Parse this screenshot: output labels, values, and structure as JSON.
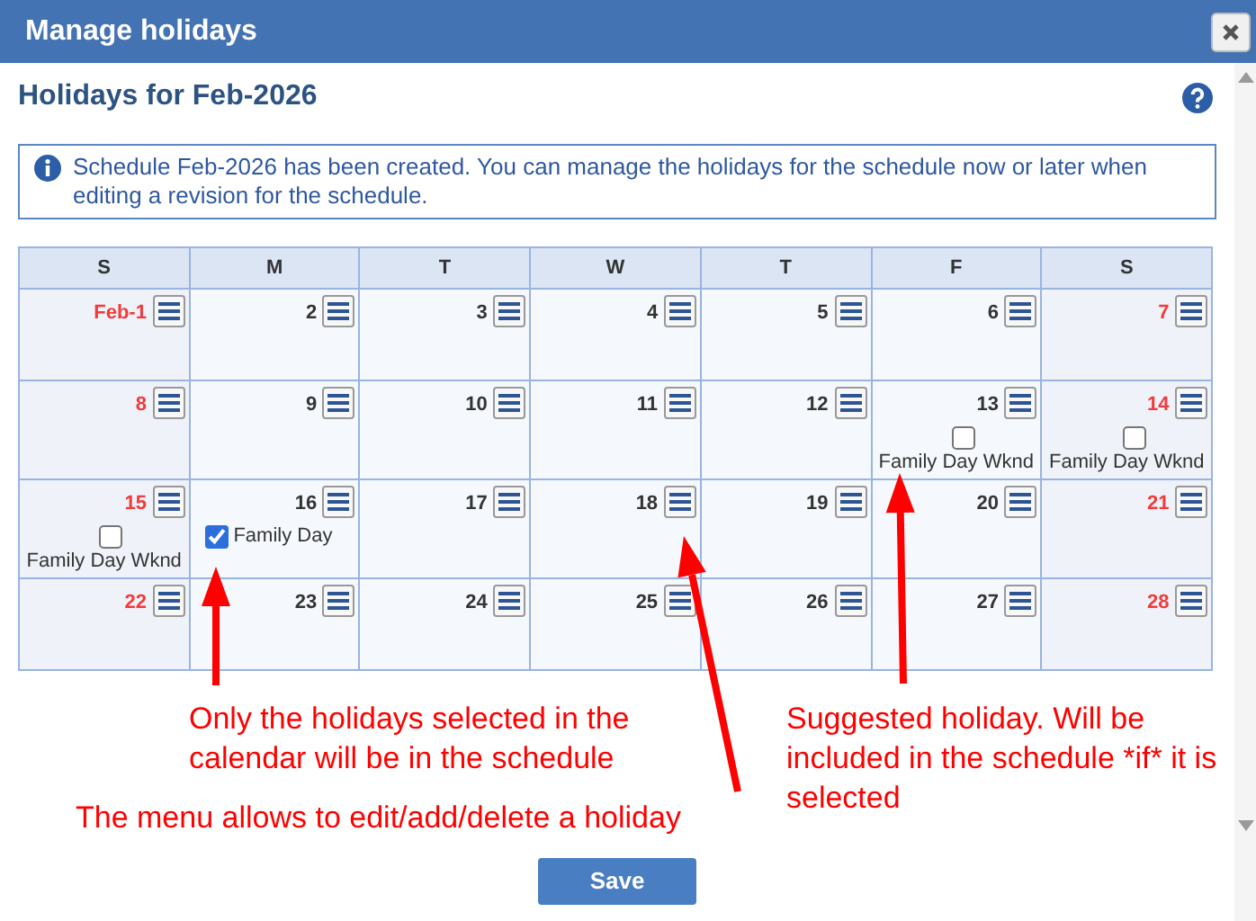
{
  "window": {
    "title": "Manage holidays"
  },
  "heading": "Holidays for Feb-2026",
  "info": "Schedule Feb-2026 has been created. You can manage the holidays for the schedule now or later when editing a revision for the schedule.",
  "calendar": {
    "columns": [
      "S",
      "M",
      "T",
      "W",
      "T",
      "F",
      "S"
    ],
    "weeks": [
      [
        {
          "date": "Feb-1",
          "weekend": true
        },
        {
          "date": "2",
          "weekend": false
        },
        {
          "date": "3",
          "weekend": false
        },
        {
          "date": "4",
          "weekend": false
        },
        {
          "date": "5",
          "weekend": false
        },
        {
          "date": "6",
          "weekend": false
        },
        {
          "date": "7",
          "weekend": true
        }
      ],
      [
        {
          "date": "8",
          "weekend": true
        },
        {
          "date": "9",
          "weekend": false
        },
        {
          "date": "10",
          "weekend": false
        },
        {
          "date": "11",
          "weekend": false
        },
        {
          "date": "12",
          "weekend": false
        },
        {
          "date": "13",
          "weekend": false,
          "holiday": {
            "name": "Family Day Wknd",
            "checked": false
          }
        },
        {
          "date": "14",
          "weekend": true,
          "holiday": {
            "name": "Family Day Wknd",
            "checked": false
          }
        }
      ],
      [
        {
          "date": "15",
          "weekend": true,
          "holiday": {
            "name": "Family Day Wknd",
            "checked": false
          }
        },
        {
          "date": "16",
          "weekend": false,
          "holiday": {
            "name": "Family Day",
            "checked": true
          }
        },
        {
          "date": "17",
          "weekend": false
        },
        {
          "date": "18",
          "weekend": false
        },
        {
          "date": "19",
          "weekend": false
        },
        {
          "date": "20",
          "weekend": false
        },
        {
          "date": "21",
          "weekend": true
        }
      ],
      [
        {
          "date": "22",
          "weekend": true
        },
        {
          "date": "23",
          "weekend": false
        },
        {
          "date": "24",
          "weekend": false
        },
        {
          "date": "25",
          "weekend": false
        },
        {
          "date": "26",
          "weekend": false
        },
        {
          "date": "27",
          "weekend": false
        },
        {
          "date": "28",
          "weekend": true
        }
      ]
    ]
  },
  "annotations": [
    {
      "text": "Only the holidays selected in the calendar will be in the schedule"
    },
    {
      "text": "The menu allows to edit/add/delete a holiday"
    },
    {
      "text": "Suggested holiday. Will be included in the schedule *if* it is selected"
    }
  ],
  "buttons": [
    "Save"
  ]
}
